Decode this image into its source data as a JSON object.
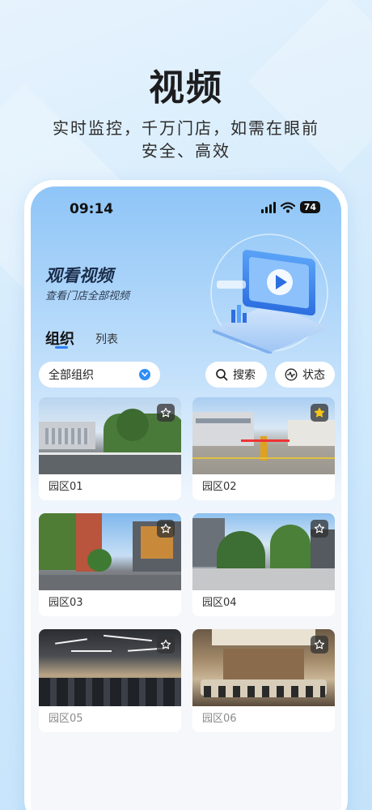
{
  "hero": {
    "title": "视频",
    "subtitle_line1": "实时监控，千万门店，如需在眼前",
    "subtitle_line2": "安全、高效"
  },
  "status_bar": {
    "time": "09:14",
    "battery": "74"
  },
  "page": {
    "title": "观看视频",
    "subtitle": "查看门店全部视频"
  },
  "tabs": [
    {
      "label": "组织",
      "active": true
    },
    {
      "label": "列表",
      "active": false
    }
  ],
  "filters": {
    "org_select": "全部组织",
    "search_label": "搜索",
    "state_label": "状态"
  },
  "cards": [
    {
      "label": "园区01",
      "starred": false,
      "scene": "street"
    },
    {
      "label": "园区02",
      "starred": true,
      "scene": "gate"
    },
    {
      "label": "园区03",
      "starred": false,
      "scene": "campus"
    },
    {
      "label": "园区04",
      "starred": false,
      "scene": "plaza"
    },
    {
      "label": "园区05",
      "starred": false,
      "scene": "office"
    },
    {
      "label": "园区06",
      "starred": false,
      "scene": "meeting"
    }
  ],
  "colors": {
    "accent": "#2e7ff5",
    "star_active": "#f5c518"
  }
}
